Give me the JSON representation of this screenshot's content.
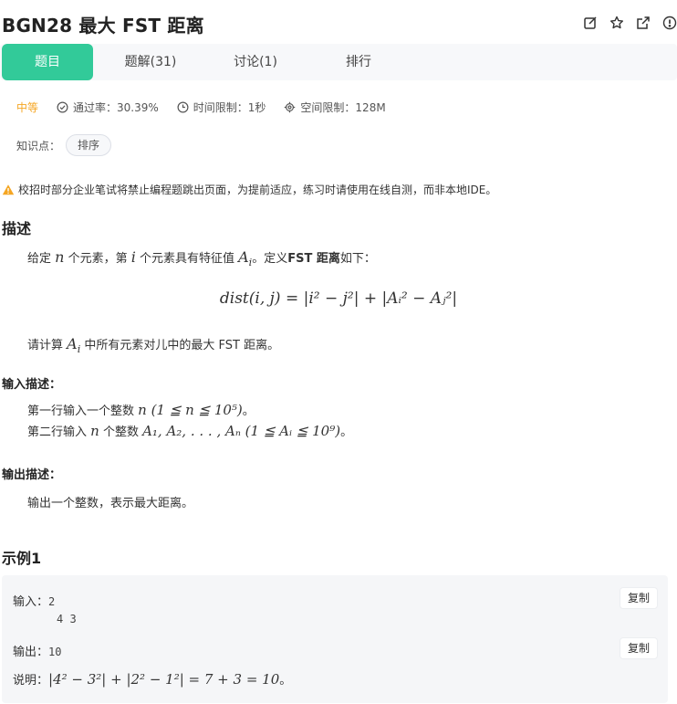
{
  "header": {
    "title": "BGN28  最大 FST 距离",
    "icons": [
      "edit-icon",
      "star-icon",
      "share-icon",
      "info-icon"
    ]
  },
  "tabs": [
    {
      "label": "题目",
      "active": true
    },
    {
      "label": "题解(31)",
      "active": false
    },
    {
      "label": "讨论(1)",
      "active": false
    },
    {
      "label": "排行",
      "active": false
    }
  ],
  "meta": {
    "difficulty": "中等",
    "pass_rate": "通过率：30.39%",
    "time_limit": "时间限制：1秒",
    "space_limit": "空间限制：128M"
  },
  "tags": {
    "label": "知识点：",
    "items": [
      "排序"
    ]
  },
  "warning": "校招时部分企业笔试将禁止编程题跳出页面，为提前适应，练习时请使用在线自测，而非本地IDE。",
  "description": {
    "heading": "描述",
    "p1_a": "给定 ",
    "p1_n": "n",
    "p1_b": " 个元素，第 ",
    "p1_i": "i",
    "p1_c": " 个元素具有特征值 ",
    "p1_Ai": "A",
    "p1_Ai_sub": "i",
    "p1_d": "。定义",
    "p1_bold": "FST 距离",
    "p1_e": "如下：",
    "formula": "dist(i, j) = |i² − j²| + |Aᵢ² − Aⱼ²|",
    "p2_a": "请计算 ",
    "p2_Ai": "A",
    "p2_Ai_sub": "i",
    "p2_b": " 中所有元素对儿中的最大 FST 距离。"
  },
  "input_desc": {
    "heading": "输入描述：",
    "line1_a": "第一行输入一个整数 ",
    "line1_math": "n (1 ≦ n ≦ 10⁵)",
    "line1_b": "。",
    "line2_a": "第二行输入 ",
    "line2_n": "n",
    "line2_b": " 个整数 ",
    "line2_math": "A₁, A₂, . . . , Aₙ (1 ≦ Aᵢ ≦ 10⁹)",
    "line2_c": "。"
  },
  "output_desc": {
    "heading": "输出描述：",
    "line1": "输出一个整数，表示最大距离。"
  },
  "example": {
    "heading": "示例1",
    "input_label": "输入：",
    "input_lines": [
      "2",
      "4 3"
    ],
    "output_label": "输出：",
    "output_value": "10",
    "copy_label": "复制",
    "explain_label": "说明：",
    "explain_math": "|4² − 3²| + |2² − 1²| = 7 + 3 = 10",
    "explain_end": "。"
  },
  "colors": {
    "accent": "#32ca99",
    "difficulty": "#f5a623",
    "warning": "#f5a623"
  }
}
